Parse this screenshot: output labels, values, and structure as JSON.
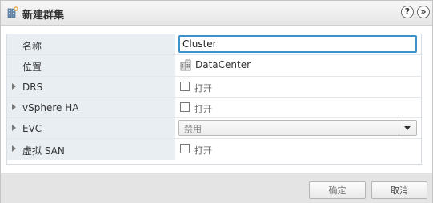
{
  "dialog": {
    "title": "新建群集",
    "help_label": "?",
    "collapse_label": "»"
  },
  "rows": [
    {
      "label": "名称",
      "value": "Cluster"
    },
    {
      "label": "位置",
      "value": "DataCenter",
      "icon": "datacenter-icon"
    },
    {
      "label": "DRS",
      "checkbox_label": "打开",
      "checked": false
    },
    {
      "label": "vSphere HA",
      "checkbox_label": "打开",
      "checked": false
    },
    {
      "label": "EVC",
      "select_value": "禁用"
    },
    {
      "label": "虚拟 SAN",
      "checkbox_label": "打开",
      "checked": false
    }
  ],
  "footer": {
    "ok_label": "确定",
    "cancel_label": "取消"
  },
  "colors": {
    "input_focus_border": "#3c93c9",
    "label_column_bg": "#e9eef3"
  }
}
